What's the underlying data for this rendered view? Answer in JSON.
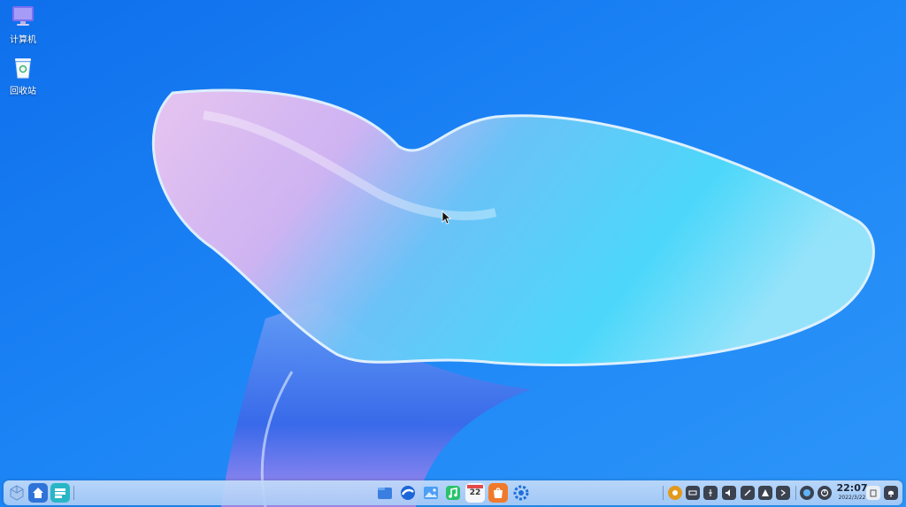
{
  "desktop": {
    "icons": [
      {
        "label": "计算机",
        "icon": "monitor-icon"
      },
      {
        "label": "回收站",
        "icon": "trash-bin-icon"
      }
    ]
  },
  "taskbar": {
    "left_buttons": [
      "launcher-cube-icon",
      "home-folder-icon",
      "multitask-view-icon"
    ],
    "center_apps": [
      "file-manager-icon",
      "browser-icon",
      "image-viewer-icon",
      "music-icon",
      "calendar-icon",
      "app-store-icon",
      "settings-gear-icon"
    ],
    "calendar_day": "22",
    "tray_icons": [
      "notification-app-icon",
      "keyboard-icon",
      "usb-icon",
      "volume-icon",
      "pen-icon",
      "network-icon",
      "expand-arrow-icon",
      "browser-tray-icon",
      "power-icon"
    ],
    "clock": {
      "time": "22:07",
      "date": "2022/3/22"
    },
    "end_icons": [
      "clipboard-icon",
      "notification-bell-icon"
    ]
  },
  "colors": {
    "accent": "#1f80f5",
    "taskbar": "#bcd7f8"
  }
}
